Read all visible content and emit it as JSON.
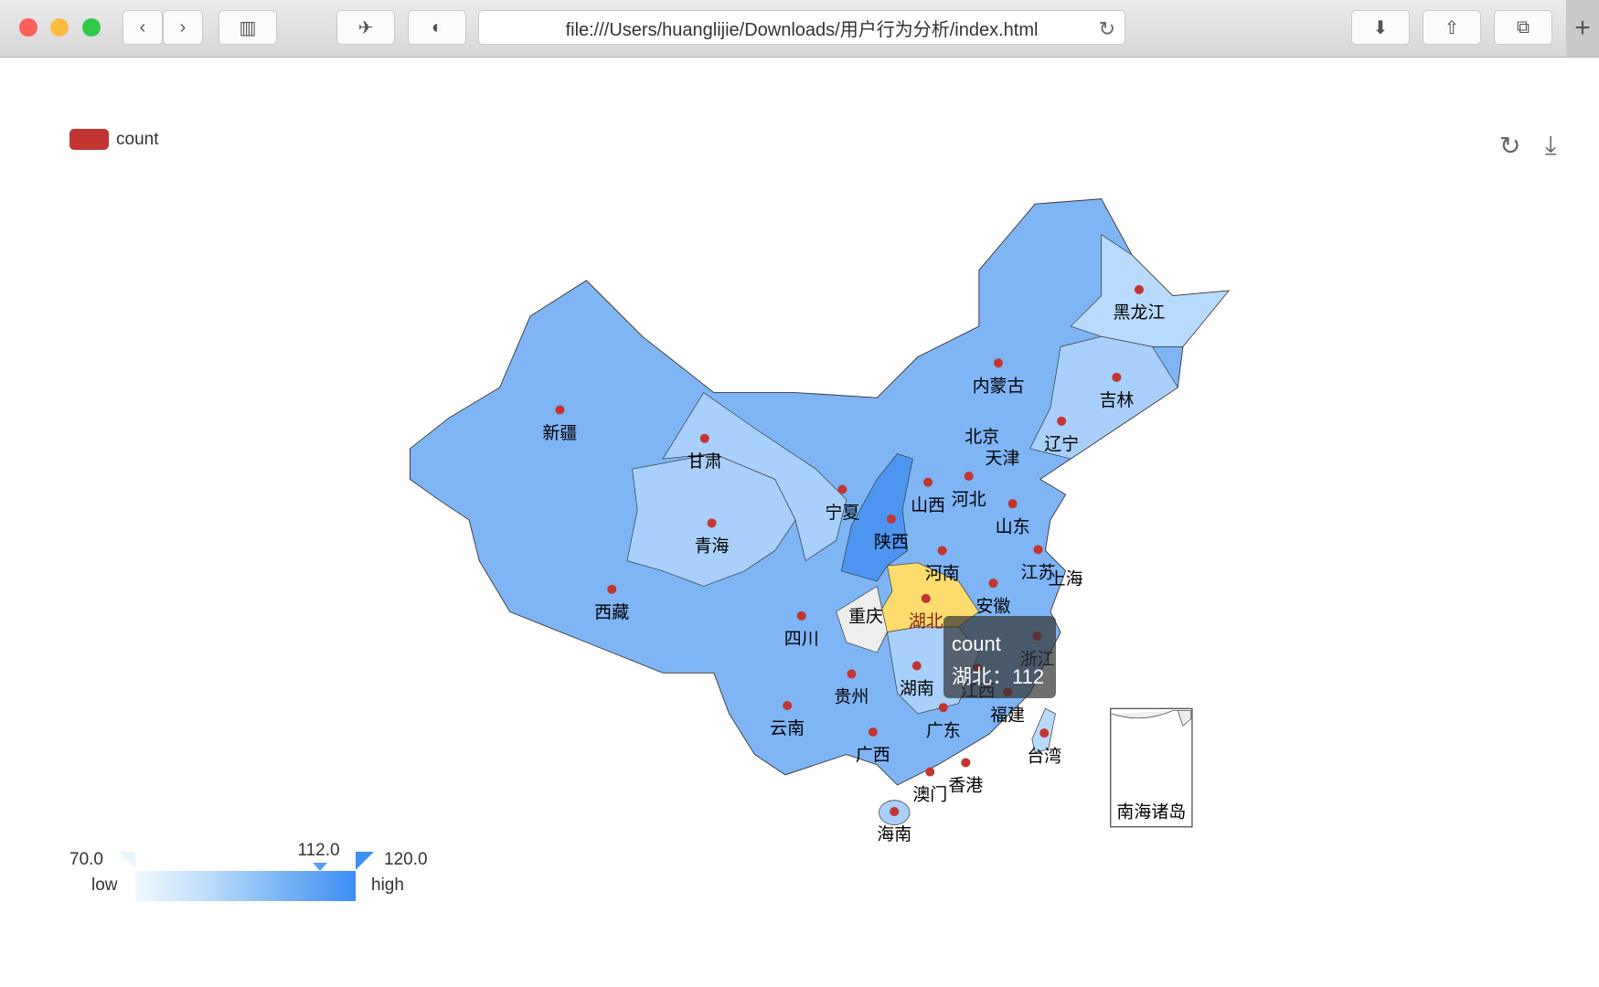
{
  "browser": {
    "url": "file:///Users/huanglijie/Downloads/用户行为分析/index.html",
    "icons": [
      "back-icon",
      "forward-icon",
      "sidebar-icon",
      "bird-icon",
      "shield-icon",
      "reload-icon",
      "download-icon",
      "share-icon",
      "tabs-icon",
      "new-tab-icon"
    ]
  },
  "chart_data": {
    "type": "map",
    "map": "china",
    "legend": {
      "series_name": "count",
      "color": "#c23531",
      "placement": "top-left"
    },
    "visual_map": {
      "min_label": "70.0",
      "max_label": "120.0",
      "min": 70,
      "max": 120,
      "low_text": "low",
      "high_text": "high",
      "pointer_label": "112.0",
      "pointer_value": 112,
      "colors": [
        "#f0faff",
        "#3d8ef5"
      ]
    },
    "regions": [
      {
        "name": "新疆"
      },
      {
        "name": "甘肃"
      },
      {
        "name": "青海"
      },
      {
        "name": "西藏"
      },
      {
        "name": "四川"
      },
      {
        "name": "宁夏"
      },
      {
        "name": "陕西"
      },
      {
        "name": "山西"
      },
      {
        "name": "河北"
      },
      {
        "name": "北京"
      },
      {
        "name": "天津"
      },
      {
        "name": "内蒙古"
      },
      {
        "name": "黑龙江"
      },
      {
        "name": "吉林"
      },
      {
        "name": "辽宁"
      },
      {
        "name": "山东"
      },
      {
        "name": "河南"
      },
      {
        "name": "江苏"
      },
      {
        "name": "上海"
      },
      {
        "name": "安徽"
      },
      {
        "name": "湖北",
        "value": 112
      },
      {
        "name": "重庆"
      },
      {
        "name": "浙江"
      },
      {
        "name": "湖南"
      },
      {
        "name": "江西"
      },
      {
        "name": "贵州"
      },
      {
        "name": "福建"
      },
      {
        "name": "云南"
      },
      {
        "name": "广东"
      },
      {
        "name": "广西"
      },
      {
        "name": "台湾"
      },
      {
        "name": "香港"
      },
      {
        "name": "澳门"
      },
      {
        "name": "海南"
      }
    ],
    "inset_label": "南海诸岛",
    "highlight_color": "#fcdc6c",
    "tooltip": {
      "title": "count",
      "text": "湖北：112"
    },
    "toolbox": [
      "restore-icon",
      "save-image-icon"
    ]
  }
}
